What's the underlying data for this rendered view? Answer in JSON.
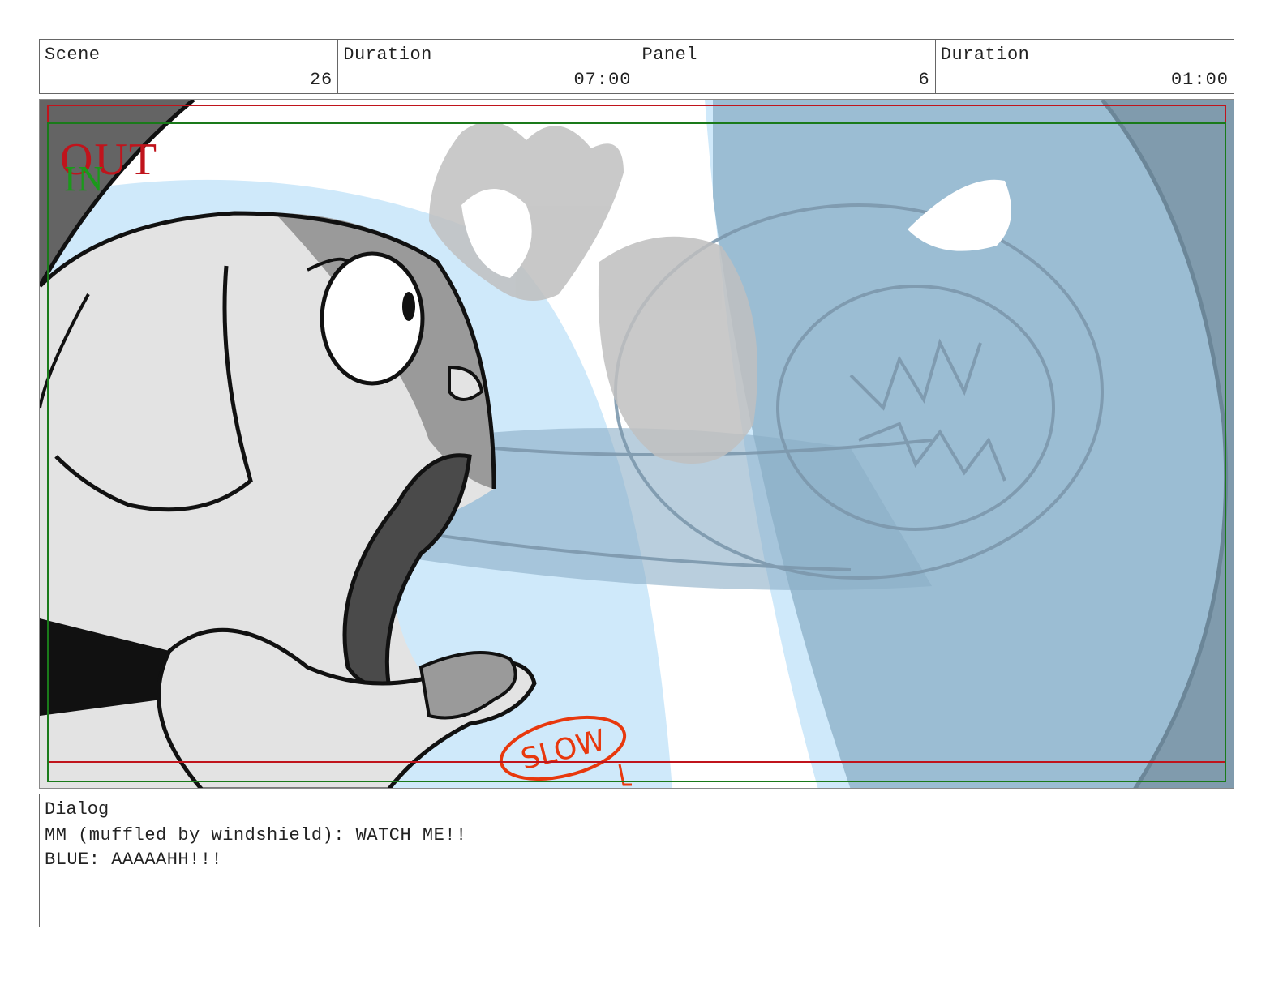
{
  "header": {
    "scene_label": "Scene",
    "scene_value": "26",
    "scene_duration_label": "Duration",
    "scene_duration_value": "07:00",
    "panel_label": "Panel",
    "panel_value": "6",
    "panel_duration_label": "Duration",
    "panel_duration_value": "01:00"
  },
  "panel": {
    "transition_out": "OUT",
    "transition_in": "IN",
    "note": "SLOW",
    "colors": {
      "safe_frame": "#c0141c",
      "action_frame": "#1a7a1a",
      "sky": "#cfe9fa",
      "shadow_blue": "#8aaec6",
      "dark_corner": "#646464",
      "note_red": "#e8380d"
    }
  },
  "dialog": {
    "label": "Dialog",
    "lines": [
      "MM (muffled by windshield): WATCH ME!!",
      "BLUE: AAAAAHH!!!"
    ]
  }
}
